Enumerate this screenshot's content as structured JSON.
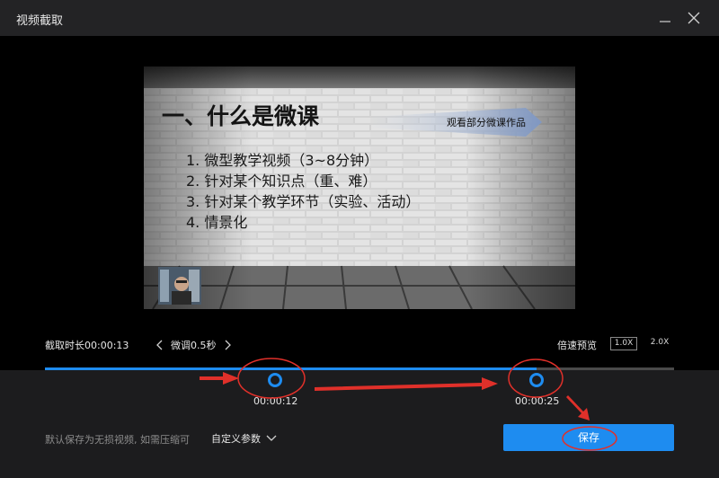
{
  "window": {
    "title": "视频截取"
  },
  "video": {
    "slide_title": "一、什么是微课",
    "banner_text": "观看部分微课作品",
    "points": [
      "1. 微型教学视频（3~8分钟）",
      "2. 针对某个知识点（重、难）",
      "3. 针对某个教学环节（实验、活动）",
      "4. 情景化"
    ]
  },
  "controls": {
    "duration": "截取时长00:00:13",
    "nudge": "微调0.5秒",
    "speed_preview": "倍速预览",
    "speed_options": [
      "1.0X",
      "2.0X"
    ],
    "start_time": "00:00:12",
    "end_time": "00:00:25",
    "hint": "默认保存为无损视频, 如需压缩可",
    "custom_params": "自定义参数",
    "save": "保存"
  },
  "colors": {
    "accent": "#1e8cf0",
    "annotation": "#e0302a"
  }
}
